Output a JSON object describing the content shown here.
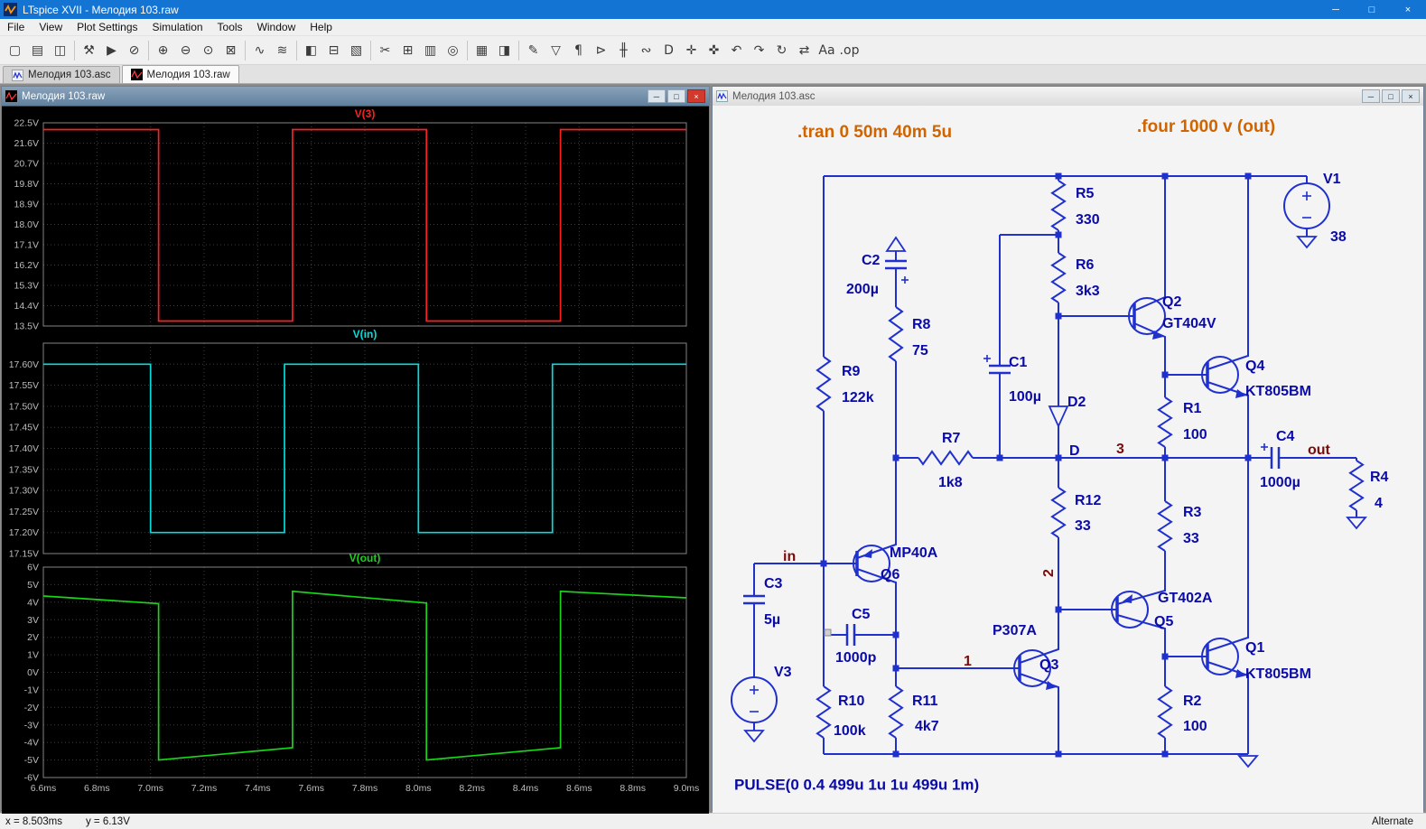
{
  "window": {
    "title": "LTspice XVII - Мелодия 103.raw"
  },
  "icons": {
    "minimize": "─",
    "restore": "□",
    "close": "×"
  },
  "menu": {
    "items": [
      "File",
      "View",
      "Plot Settings",
      "Simulation",
      "Tools",
      "Window",
      "Help"
    ]
  },
  "toolbar": {
    "items": [
      {
        "name": "new-schematic",
        "glyph": "▢"
      },
      {
        "name": "open-file",
        "glyph": "▤"
      },
      {
        "name": "save",
        "glyph": "◫"
      },
      {
        "name": "control-panel",
        "glyph": "⚒"
      },
      {
        "name": "run-simulation",
        "glyph": "▶"
      },
      {
        "name": "halt-simulation",
        "glyph": "⊘"
      },
      {
        "name": "zoom-in",
        "glyph": "⊕"
      },
      {
        "name": "zoom-out",
        "glyph": "⊖"
      },
      {
        "name": "zoom-full-extents",
        "glyph": "⊙"
      },
      {
        "name": "zoom-area",
        "glyph": "⊠"
      },
      {
        "name": "autorange-y",
        "glyph": "∿"
      },
      {
        "name": "fft",
        "glyph": "≋"
      },
      {
        "name": "tile-vertically",
        "glyph": "◧"
      },
      {
        "name": "tile-horizontally",
        "glyph": "⊟"
      },
      {
        "name": "cascade-windows",
        "glyph": "▧"
      },
      {
        "name": "cut",
        "glyph": "✂"
      },
      {
        "name": "copy",
        "glyph": "⊞"
      },
      {
        "name": "paste",
        "glyph": "▥"
      },
      {
        "name": "find",
        "glyph": "◎"
      },
      {
        "name": "print",
        "glyph": "▦"
      },
      {
        "name": "print-preview",
        "glyph": "◨"
      },
      {
        "name": "draw-wire",
        "glyph": "✎"
      },
      {
        "name": "place-ground",
        "glyph": "▽"
      },
      {
        "name": "place-label",
        "glyph": "¶"
      },
      {
        "name": "place-diode",
        "glyph": "⊳"
      },
      {
        "name": "place-capacitor",
        "glyph": "╫"
      },
      {
        "name": "place-inductor",
        "glyph": "∾"
      },
      {
        "name": "place-component",
        "glyph": "D"
      },
      {
        "name": "move",
        "glyph": "✛"
      },
      {
        "name": "drag",
        "glyph": "✜"
      },
      {
        "name": "undo",
        "glyph": "↶"
      },
      {
        "name": "redo",
        "glyph": "↷"
      },
      {
        "name": "rotate",
        "glyph": "↻"
      },
      {
        "name": "mirror",
        "glyph": "⇄"
      },
      {
        "name": "text",
        "glyph": "Aa"
      },
      {
        "name": "spice-directive",
        "glyph": ".op"
      }
    ]
  },
  "tabs": [
    {
      "label": "Мелодия 103.asc"
    },
    {
      "label": "Мелодия 103.raw"
    }
  ],
  "wave_window": {
    "title": "Мелодия 103.raw"
  },
  "schematic_window": {
    "title": "Мелодия 103.asc"
  },
  "statusbar": {
    "x_readout": "x = 8.503ms",
    "y_readout": "y = 6.13V",
    "right": "Alternate"
  },
  "colors": {
    "titlebar": "#1474d4",
    "wire": "#2030cf",
    "component_text": "#0a0aa8",
    "net_label_text": "#7c0a0a",
    "directive_text": "#d06400",
    "schematic_background": "#f4f4f4"
  },
  "chart_data": {
    "type": "line",
    "background": "#000000",
    "grid": true,
    "x_range_ms": [
      6.6,
      9.0
    ],
    "x_ticks": [
      "6.6ms",
      "6.8ms",
      "7.0ms",
      "7.2ms",
      "7.4ms",
      "7.6ms",
      "7.8ms",
      "8.0ms",
      "8.2ms",
      "8.4ms",
      "8.6ms",
      "8.8ms",
      "9.0ms"
    ],
    "panes": [
      {
        "title": "V(3)",
        "color": "#ff1f1f",
        "ylim": [
          13.5,
          22.5
        ],
        "y_ticks": [
          "22.5V",
          "21.6V",
          "20.7V",
          "19.8V",
          "18.9V",
          "18.0V",
          "17.1V",
          "16.2V",
          "15.3V",
          "14.4V",
          "13.5V"
        ],
        "points": [
          [
            6.6,
            22.2
          ],
          [
            7.03,
            22.2
          ],
          [
            7.03,
            13.72
          ],
          [
            7.53,
            13.72
          ],
          [
            7.53,
            22.2
          ],
          [
            8.03,
            22.2
          ],
          [
            8.03,
            13.72
          ],
          [
            8.53,
            13.72
          ],
          [
            8.53,
            22.2
          ],
          [
            9.0,
            22.2
          ]
        ]
      },
      {
        "title": "V(in)",
        "color": "#00dede",
        "ylim": [
          17.15,
          17.65
        ],
        "y_ticks": [
          "17.60V",
          "17.55V",
          "17.50V",
          "17.45V",
          "17.40V",
          "17.35V",
          "17.30V",
          "17.25V",
          "17.20V",
          "17.15V"
        ],
        "points": [
          [
            6.6,
            17.6
          ],
          [
            7.0,
            17.6
          ],
          [
            7.0,
            17.2
          ],
          [
            7.5,
            17.2
          ],
          [
            7.5,
            17.6
          ],
          [
            8.0,
            17.6
          ],
          [
            8.0,
            17.2
          ],
          [
            8.5,
            17.2
          ],
          [
            8.5,
            17.6
          ],
          [
            9.0,
            17.6
          ]
        ]
      },
      {
        "title": "V(out)",
        "color": "#1ad41a",
        "ylim": [
          -6,
          6
        ],
        "y_ticks": [
          "6V",
          "5V",
          "4V",
          "3V",
          "2V",
          "1V",
          "0V",
          "-1V",
          "-2V",
          "-3V",
          "-4V",
          "-5V",
          "-6V"
        ],
        "points": [
          [
            6.6,
            4.35
          ],
          [
            7.03,
            3.92
          ],
          [
            7.03,
            -5.0
          ],
          [
            7.53,
            -4.3
          ],
          [
            7.53,
            4.62
          ],
          [
            8.03,
            3.95
          ],
          [
            8.03,
            -5.0
          ],
          [
            8.53,
            -4.3
          ],
          [
            8.53,
            4.62
          ],
          [
            9.0,
            4.25
          ]
        ]
      }
    ]
  },
  "schematic": {
    "directives": [
      ".tran 0 50m 40m 5u",
      ".four 1000 v (out)"
    ],
    "net_labels": [
      "in",
      "out",
      "1",
      "2",
      "3"
    ],
    "components": [
      {
        "name": "V1",
        "value": "38"
      },
      {
        "name": "R5",
        "value": "330"
      },
      {
        "name": "R6",
        "value": "3k3"
      },
      {
        "name": "Q2",
        "value": "GT404V"
      },
      {
        "name": "C2",
        "value": "200µ"
      },
      {
        "name": "R8",
        "value": "75"
      },
      {
        "name": "C1",
        "value": "100µ"
      },
      {
        "name": "D2",
        "value": "D"
      },
      {
        "name": "Q4",
        "value": "KT805BM"
      },
      {
        "name": "R9",
        "value": "122k"
      },
      {
        "name": "R1",
        "value": "100"
      },
      {
        "name": "R7",
        "value": "1k8"
      },
      {
        "name": "C4",
        "value": "1000µ"
      },
      {
        "name": "R4",
        "value": "4"
      },
      {
        "name": "R12",
        "value": "33"
      },
      {
        "name": "R3",
        "value": "33"
      },
      {
        "name": "Q6",
        "value": "MP40A"
      },
      {
        "name": "C3",
        "value": "5µ"
      },
      {
        "name": "Q5",
        "value": "GT402A"
      },
      {
        "name": "C5",
        "value": "1000p"
      },
      {
        "name": "Q3",
        "value": "P307A"
      },
      {
        "name": "Q1",
        "value": "KT805BM"
      },
      {
        "name": "V3",
        "value": "PULSE(0 0.4 499u 1u 1u 499u 1m)"
      },
      {
        "name": "R10",
        "value": "100k"
      },
      {
        "name": "R11",
        "value": "4k7"
      },
      {
        "name": "R2",
        "value": "100"
      }
    ]
  }
}
